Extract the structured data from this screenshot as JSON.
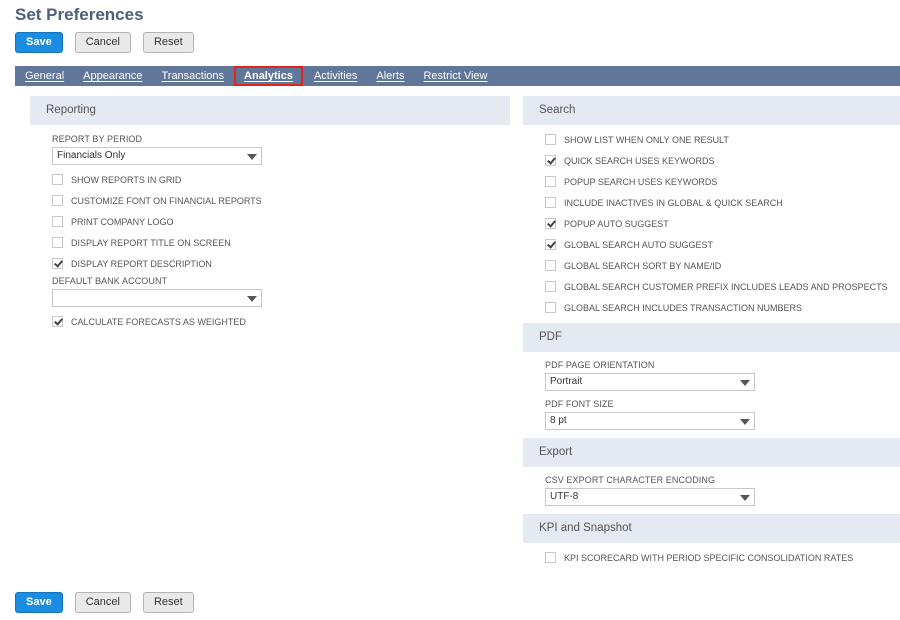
{
  "page": {
    "title": "Set Preferences"
  },
  "buttons": {
    "save": "Save",
    "cancel": "Cancel",
    "reset": "Reset"
  },
  "tabs": [
    {
      "label": "General",
      "active": false
    },
    {
      "label": "Appearance",
      "active": false
    },
    {
      "label": "Transactions",
      "active": false
    },
    {
      "label": "Analytics",
      "active": true
    },
    {
      "label": "Activities",
      "active": false
    },
    {
      "label": "Alerts",
      "active": false
    },
    {
      "label": "Restrict View",
      "active": false
    }
  ],
  "reporting": {
    "heading": "Reporting",
    "report_by_period_label": "REPORT BY PERIOD",
    "report_by_period_value": "Financials Only",
    "checks": [
      {
        "label": "SHOW REPORTS IN GRID",
        "checked": false
      },
      {
        "label": "CUSTOMIZE FONT ON FINANCIAL REPORTS",
        "checked": false
      },
      {
        "label": "PRINT COMPANY LOGO",
        "checked": false
      },
      {
        "label": "DISPLAY REPORT TITLE ON SCREEN",
        "checked": false
      },
      {
        "label": "DISPLAY REPORT DESCRIPTION",
        "checked": true
      }
    ],
    "default_bank_label": "DEFAULT BANK ACCOUNT",
    "default_bank_value": "",
    "forecast_label": "CALCULATE FORECASTS AS WEIGHTED",
    "forecast_checked": true
  },
  "search": {
    "heading": "Search",
    "checks": [
      {
        "label": "SHOW LIST WHEN ONLY ONE RESULT",
        "checked": false
      },
      {
        "label": "QUICK SEARCH USES KEYWORDS",
        "checked": true
      },
      {
        "label": "POPUP SEARCH USES KEYWORDS",
        "checked": false
      },
      {
        "label": "INCLUDE INACTIVES IN GLOBAL & QUICK SEARCH",
        "checked": false
      },
      {
        "label": "POPUP AUTO SUGGEST",
        "checked": true
      },
      {
        "label": "GLOBAL SEARCH AUTO SUGGEST",
        "checked": true
      },
      {
        "label": "GLOBAL SEARCH SORT BY NAME/ID",
        "checked": false
      },
      {
        "label": "GLOBAL SEARCH CUSTOMER PREFIX INCLUDES LEADS AND PROSPECTS",
        "checked": false
      },
      {
        "label": "GLOBAL SEARCH INCLUDES TRANSACTION NUMBERS",
        "checked": false
      }
    ]
  },
  "pdf": {
    "heading": "PDF",
    "orientation_label": "PDF PAGE ORIENTATION",
    "orientation_value": "Portrait",
    "font_size_label": "PDF FONT SIZE",
    "font_size_value": "8 pt"
  },
  "export": {
    "heading": "Export",
    "encoding_label": "CSV EXPORT CHARACTER ENCODING",
    "encoding_value": "UTF-8"
  },
  "kpi": {
    "heading": "KPI and Snapshot",
    "check_label": "KPI SCORECARD WITH PERIOD SPECIFIC CONSOLIDATION RATES",
    "check_checked": false
  },
  "colors": {
    "accent": "#1a8de0",
    "tab_bar": "#607799",
    "section_bg": "#e5e9f1",
    "highlight": "#e0241b"
  }
}
